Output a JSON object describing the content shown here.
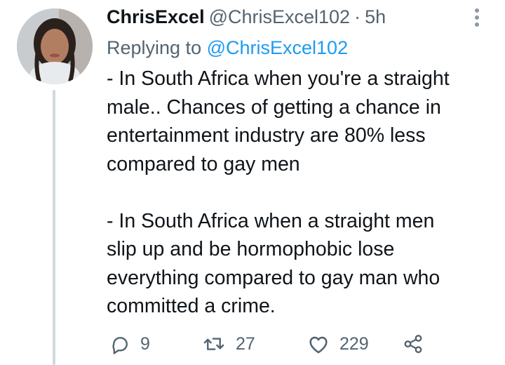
{
  "tweet": {
    "display_name": "ChrisExcel",
    "handle": "@ChrisExcel102",
    "separator": "·",
    "time": "5h",
    "replying_prefix": "Replying to",
    "replying_handle": "@ChrisExcel102",
    "body": {
      "paragraph_1": [
        "- In South Africa when you're a straight",
        "male.. Chances of getting a chance in",
        "entertainment industry are 80% less",
        "compared to gay men"
      ],
      "paragraph_2": [
        "- In South Africa when a straight men",
        "slip up and be hormophobic lose",
        "everything compared to gay man who",
        "committed a crime."
      ]
    },
    "actions": {
      "reply_count": "9",
      "retweet_count": "27",
      "like_count": "229"
    }
  },
  "icons": {
    "more": "more-vertical-icon",
    "reply": "reply-icon",
    "retweet": "retweet-icon",
    "like": "heart-icon",
    "share": "share-icon"
  },
  "colors": {
    "text": "#0f1419",
    "secondary": "#536471",
    "link": "#1d9bf0",
    "thread_line": "#cfd9de"
  }
}
